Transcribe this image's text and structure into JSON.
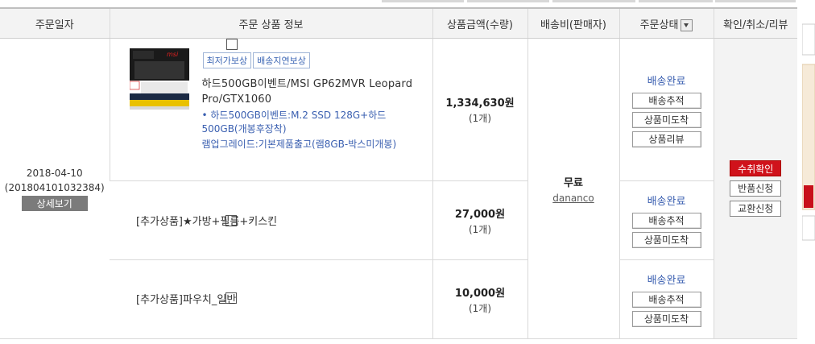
{
  "header": {
    "col_date": "주문일자",
    "col_product": "주문 상품 정보",
    "col_amount": "상품금액(수량)",
    "col_shipping": "배송비(판매자)",
    "col_status": "주문상태",
    "col_actions": "확인/취소/리뷰"
  },
  "order": {
    "date": "2018-04-10",
    "order_no": "(201804101032384)",
    "detail_button": "상세보기",
    "shipping": {
      "fee": "무료",
      "seller": "dananco"
    },
    "actions": {
      "confirm": "수취확인",
      "return": "반품신청",
      "exchange": "교환신청"
    }
  },
  "items": [
    {
      "tags": [
        "최저가보상",
        "배송지연보상"
      ],
      "name": "하드500GB이벤트/MSI GP62MVR Leopard Pro/GTX1060",
      "option1": "• 하드500GB이벤트:M.2 SSD 128G+하드500GB(개봉후장착)",
      "option2": "램업그레이드:기본제품출고(램8GB-박스미개봉)",
      "price": "1,334,630원",
      "qty": "(1개)",
      "status": "배송완료",
      "buttons": [
        "배송추적",
        "상품미도착",
        "상품리뷰"
      ]
    },
    {
      "name": "[추가상품]★가방+필름+키스킨",
      "price": "27,000원",
      "qty": "(1개)",
      "status": "배송완료",
      "buttons": [
        "배송추적",
        "상품미도착"
      ]
    },
    {
      "name": "[추가상품]파우치_일반",
      "price": "10,000원",
      "qty": "(1개)",
      "status": "배송완료",
      "buttons": [
        "배송추적",
        "상품미도착"
      ]
    }
  ],
  "thumb": {
    "brand": "msi"
  },
  "colors": {
    "accent_blue": "#3a5fb0",
    "confirm_red": "#d0121b",
    "detail_gray": "#7b7b7b"
  }
}
